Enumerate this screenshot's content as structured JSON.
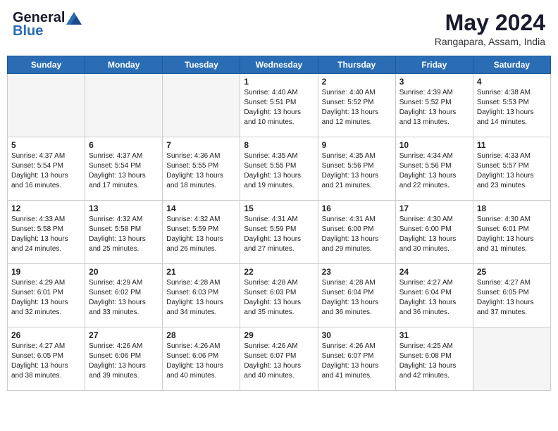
{
  "logo": {
    "general": "General",
    "blue": "Blue"
  },
  "header": {
    "month_year": "May 2024",
    "location": "Rangapara, Assam, India"
  },
  "weekdays": [
    "Sunday",
    "Monday",
    "Tuesday",
    "Wednesday",
    "Thursday",
    "Friday",
    "Saturday"
  ],
  "weeks": [
    [
      {
        "day": "",
        "sunrise": "",
        "sunset": "",
        "daylight": "",
        "empty": true
      },
      {
        "day": "",
        "sunrise": "",
        "sunset": "",
        "daylight": "",
        "empty": true
      },
      {
        "day": "",
        "sunrise": "",
        "sunset": "",
        "daylight": "",
        "empty": true
      },
      {
        "day": "1",
        "sunrise": "Sunrise: 4:40 AM",
        "sunset": "Sunset: 5:51 PM",
        "daylight": "Daylight: 13 hours and 10 minutes.",
        "empty": false
      },
      {
        "day": "2",
        "sunrise": "Sunrise: 4:40 AM",
        "sunset": "Sunset: 5:52 PM",
        "daylight": "Daylight: 13 hours and 12 minutes.",
        "empty": false
      },
      {
        "day": "3",
        "sunrise": "Sunrise: 4:39 AM",
        "sunset": "Sunset: 5:52 PM",
        "daylight": "Daylight: 13 hours and 13 minutes.",
        "empty": false
      },
      {
        "day": "4",
        "sunrise": "Sunrise: 4:38 AM",
        "sunset": "Sunset: 5:53 PM",
        "daylight": "Daylight: 13 hours and 14 minutes.",
        "empty": false
      }
    ],
    [
      {
        "day": "5",
        "sunrise": "Sunrise: 4:37 AM",
        "sunset": "Sunset: 5:54 PM",
        "daylight": "Daylight: 13 hours and 16 minutes.",
        "empty": false
      },
      {
        "day": "6",
        "sunrise": "Sunrise: 4:37 AM",
        "sunset": "Sunset: 5:54 PM",
        "daylight": "Daylight: 13 hours and 17 minutes.",
        "empty": false
      },
      {
        "day": "7",
        "sunrise": "Sunrise: 4:36 AM",
        "sunset": "Sunset: 5:55 PM",
        "daylight": "Daylight: 13 hours and 18 minutes.",
        "empty": false
      },
      {
        "day": "8",
        "sunrise": "Sunrise: 4:35 AM",
        "sunset": "Sunset: 5:55 PM",
        "daylight": "Daylight: 13 hours and 19 minutes.",
        "empty": false
      },
      {
        "day": "9",
        "sunrise": "Sunrise: 4:35 AM",
        "sunset": "Sunset: 5:56 PM",
        "daylight": "Daylight: 13 hours and 21 minutes.",
        "empty": false
      },
      {
        "day": "10",
        "sunrise": "Sunrise: 4:34 AM",
        "sunset": "Sunset: 5:56 PM",
        "daylight": "Daylight: 13 hours and 22 minutes.",
        "empty": false
      },
      {
        "day": "11",
        "sunrise": "Sunrise: 4:33 AM",
        "sunset": "Sunset: 5:57 PM",
        "daylight": "Daylight: 13 hours and 23 minutes.",
        "empty": false
      }
    ],
    [
      {
        "day": "12",
        "sunrise": "Sunrise: 4:33 AM",
        "sunset": "Sunset: 5:58 PM",
        "daylight": "Daylight: 13 hours and 24 minutes.",
        "empty": false
      },
      {
        "day": "13",
        "sunrise": "Sunrise: 4:32 AM",
        "sunset": "Sunset: 5:58 PM",
        "daylight": "Daylight: 13 hours and 25 minutes.",
        "empty": false
      },
      {
        "day": "14",
        "sunrise": "Sunrise: 4:32 AM",
        "sunset": "Sunset: 5:59 PM",
        "daylight": "Daylight: 13 hours and 26 minutes.",
        "empty": false
      },
      {
        "day": "15",
        "sunrise": "Sunrise: 4:31 AM",
        "sunset": "Sunset: 5:59 PM",
        "daylight": "Daylight: 13 hours and 27 minutes.",
        "empty": false
      },
      {
        "day": "16",
        "sunrise": "Sunrise: 4:31 AM",
        "sunset": "Sunset: 6:00 PM",
        "daylight": "Daylight: 13 hours and 29 minutes.",
        "empty": false
      },
      {
        "day": "17",
        "sunrise": "Sunrise: 4:30 AM",
        "sunset": "Sunset: 6:00 PM",
        "daylight": "Daylight: 13 hours and 30 minutes.",
        "empty": false
      },
      {
        "day": "18",
        "sunrise": "Sunrise: 4:30 AM",
        "sunset": "Sunset: 6:01 PM",
        "daylight": "Daylight: 13 hours and 31 minutes.",
        "empty": false
      }
    ],
    [
      {
        "day": "19",
        "sunrise": "Sunrise: 4:29 AM",
        "sunset": "Sunset: 6:01 PM",
        "daylight": "Daylight: 13 hours and 32 minutes.",
        "empty": false
      },
      {
        "day": "20",
        "sunrise": "Sunrise: 4:29 AM",
        "sunset": "Sunset: 6:02 PM",
        "daylight": "Daylight: 13 hours and 33 minutes.",
        "empty": false
      },
      {
        "day": "21",
        "sunrise": "Sunrise: 4:28 AM",
        "sunset": "Sunset: 6:03 PM",
        "daylight": "Daylight: 13 hours and 34 minutes.",
        "empty": false
      },
      {
        "day": "22",
        "sunrise": "Sunrise: 4:28 AM",
        "sunset": "Sunset: 6:03 PM",
        "daylight": "Daylight: 13 hours and 35 minutes.",
        "empty": false
      },
      {
        "day": "23",
        "sunrise": "Sunrise: 4:28 AM",
        "sunset": "Sunset: 6:04 PM",
        "daylight": "Daylight: 13 hours and 36 minutes.",
        "empty": false
      },
      {
        "day": "24",
        "sunrise": "Sunrise: 4:27 AM",
        "sunset": "Sunset: 6:04 PM",
        "daylight": "Daylight: 13 hours and 36 minutes.",
        "empty": false
      },
      {
        "day": "25",
        "sunrise": "Sunrise: 4:27 AM",
        "sunset": "Sunset: 6:05 PM",
        "daylight": "Daylight: 13 hours and 37 minutes.",
        "empty": false
      }
    ],
    [
      {
        "day": "26",
        "sunrise": "Sunrise: 4:27 AM",
        "sunset": "Sunset: 6:05 PM",
        "daylight": "Daylight: 13 hours and 38 minutes.",
        "empty": false
      },
      {
        "day": "27",
        "sunrise": "Sunrise: 4:26 AM",
        "sunset": "Sunset: 6:06 PM",
        "daylight": "Daylight: 13 hours and 39 minutes.",
        "empty": false
      },
      {
        "day": "28",
        "sunrise": "Sunrise: 4:26 AM",
        "sunset": "Sunset: 6:06 PM",
        "daylight": "Daylight: 13 hours and 40 minutes.",
        "empty": false
      },
      {
        "day": "29",
        "sunrise": "Sunrise: 4:26 AM",
        "sunset": "Sunset: 6:07 PM",
        "daylight": "Daylight: 13 hours and 40 minutes.",
        "empty": false
      },
      {
        "day": "30",
        "sunrise": "Sunrise: 4:26 AM",
        "sunset": "Sunset: 6:07 PM",
        "daylight": "Daylight: 13 hours and 41 minutes.",
        "empty": false
      },
      {
        "day": "31",
        "sunrise": "Sunrise: 4:25 AM",
        "sunset": "Sunset: 6:08 PM",
        "daylight": "Daylight: 13 hours and 42 minutes.",
        "empty": false
      },
      {
        "day": "",
        "sunrise": "",
        "sunset": "",
        "daylight": "",
        "empty": true
      }
    ]
  ]
}
